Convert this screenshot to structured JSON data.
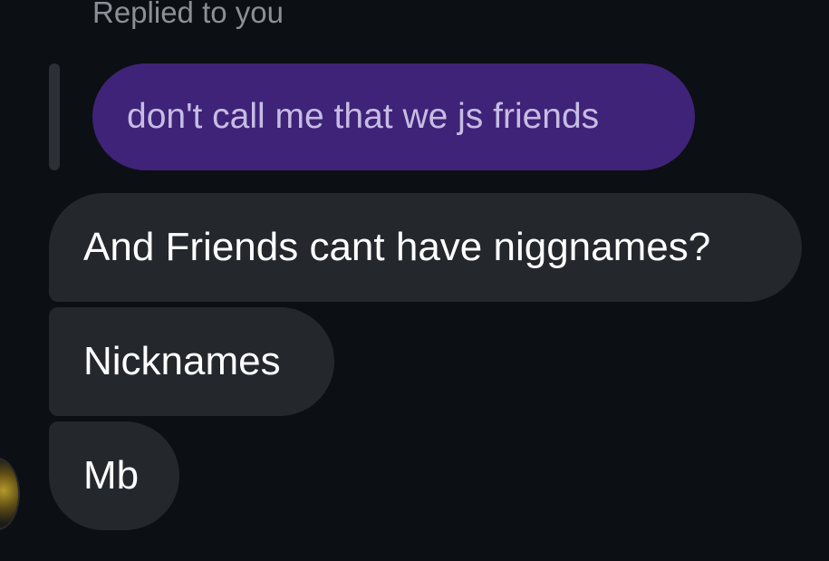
{
  "reply": {
    "header": "Replied to you",
    "quoted_message": "don't call me that we js friends"
  },
  "messages": [
    {
      "text": "And Friends cant have niggnames?"
    },
    {
      "text": "Nicknames"
    },
    {
      "text": "Mb"
    }
  ],
  "colors": {
    "background": "#0c0f14",
    "quoted_bubble": "#3f2378",
    "message_bubble": "#24272c"
  }
}
